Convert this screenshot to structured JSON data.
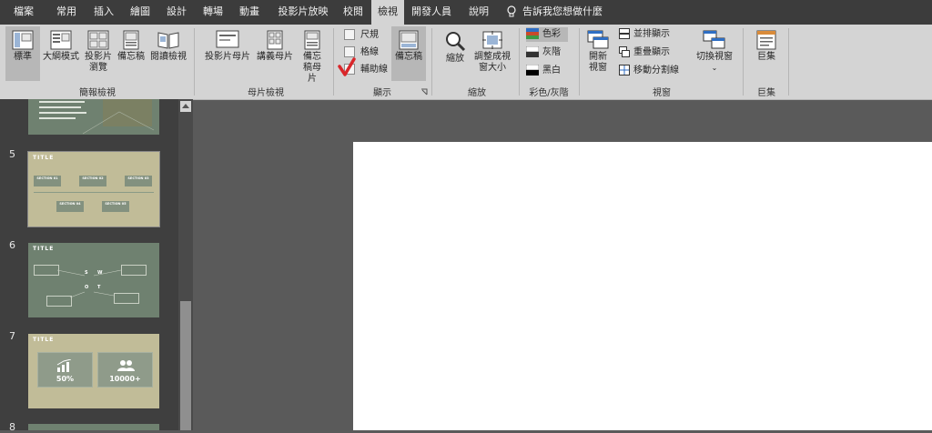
{
  "tabs": [
    "檔案",
    "常用",
    "插入",
    "繪圖",
    "設計",
    "轉場",
    "動畫",
    "投影片放映",
    "校閱",
    "檢視",
    "開發人員",
    "說明"
  ],
  "active_tab": "檢視",
  "tell_me": "告訴我您想做什麼",
  "ribbon": {
    "presentation_views": {
      "label": "簡報檢視",
      "normal": "標準",
      "outline": "大綱模式",
      "sorter": "投影片瀏覽",
      "notes": "備忘稿",
      "reading": "閱讀檢視"
    },
    "master_views": {
      "label": "母片檢視",
      "slide_master": "投影片母片",
      "handout_master": "講義母片",
      "notes_master": "備忘稿母片"
    },
    "show": {
      "label": "顯示",
      "ruler": "尺規",
      "gridlines": "格線",
      "guides": "輔助線",
      "notes_button": "備忘稿",
      "guides_checked": true
    },
    "zoom": {
      "label": "縮放",
      "zoom": "縮放",
      "fit": "調整成視窗大小"
    },
    "color": {
      "label": "彩色/灰階",
      "color": "色彩",
      "grayscale": "灰階",
      "bw": "黑白"
    },
    "window": {
      "label": "視窗",
      "new_window": "開新視窗",
      "arrange_all": "並排顯示",
      "cascade": "重疊顯示",
      "move_split": "移動分割線",
      "switch": "切換視窗"
    },
    "macros": {
      "label": "巨集",
      "macros": "巨集"
    }
  },
  "slides": [
    {
      "num": "5",
      "title": "TITLE",
      "sections": [
        "SECTION 01",
        "SECTION 02",
        "SECTION 03",
        "SECTION 04",
        "SECTION 05"
      ]
    },
    {
      "num": "6",
      "title": "TITLE",
      "swot": [
        "S",
        "W",
        "O",
        "T"
      ]
    },
    {
      "num": "7",
      "title": "TITLE",
      "stats": [
        "50%",
        "10000+"
      ]
    },
    {
      "num": "8"
    }
  ],
  "colors": {
    "slide_green": "#6f8170",
    "slide_khaki": "#c1bc98",
    "slide_box": "#83917f"
  }
}
